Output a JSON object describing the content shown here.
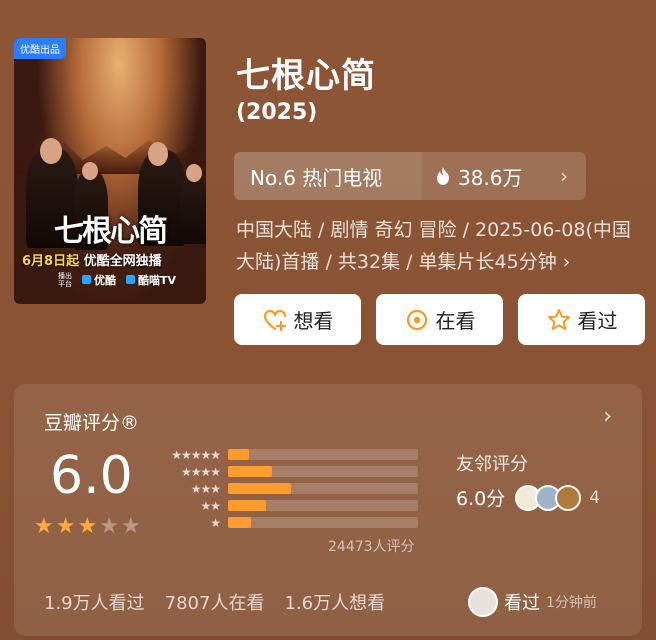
{
  "poster": {
    "badge": "优酷出品",
    "title_art": "七根心简",
    "release_date": "6月8日起",
    "release_text": "优酷全网独播",
    "platform_label": "播出平台",
    "platforms": [
      "优酷",
      "酷喵TV"
    ]
  },
  "show": {
    "title": "七根心简",
    "year": "(2025)"
  },
  "rank": {
    "label": "No.6 热门电视",
    "heat": "38.6万",
    "chevron": "›"
  },
  "meta": {
    "text": "中国大陆 / 剧情 奇幻 冒险 / 2025-06-08(中国大陆)首播 / 共32集 / 单集片长45分钟 ›"
  },
  "actions": [
    {
      "label": "想看",
      "icon": "heart-plus-icon"
    },
    {
      "label": "在看",
      "icon": "circle-dot-icon"
    },
    {
      "label": "看过",
      "icon": "star-outline-icon"
    }
  ],
  "rating": {
    "heading": "豆瓣评分®",
    "score": "6.0",
    "stars_filled": 3,
    "stars_total": 5,
    "distribution": [
      {
        "stars": "★★★★★",
        "fraction": 0.11
      },
      {
        "stars": "★★★★",
        "fraction": 0.23
      },
      {
        "stars": "★★★",
        "fraction": 0.33
      },
      {
        "stars": "★★",
        "fraction": 0.2
      },
      {
        "stars": "★",
        "fraction": 0.12
      }
    ],
    "count": "24473人评分",
    "friend_label": "友邻评分",
    "friend_score": "6.0分",
    "friend_count": "4",
    "watched": "1.9万人看过",
    "watching": "7807人在看",
    "want": "1.6万人想看",
    "recent_action": "看过",
    "recent_time": "1分钟前"
  },
  "colors": {
    "background": "#8a5534",
    "bar_fill": "#ff9c2e",
    "star_fill": "#ffa93b"
  }
}
